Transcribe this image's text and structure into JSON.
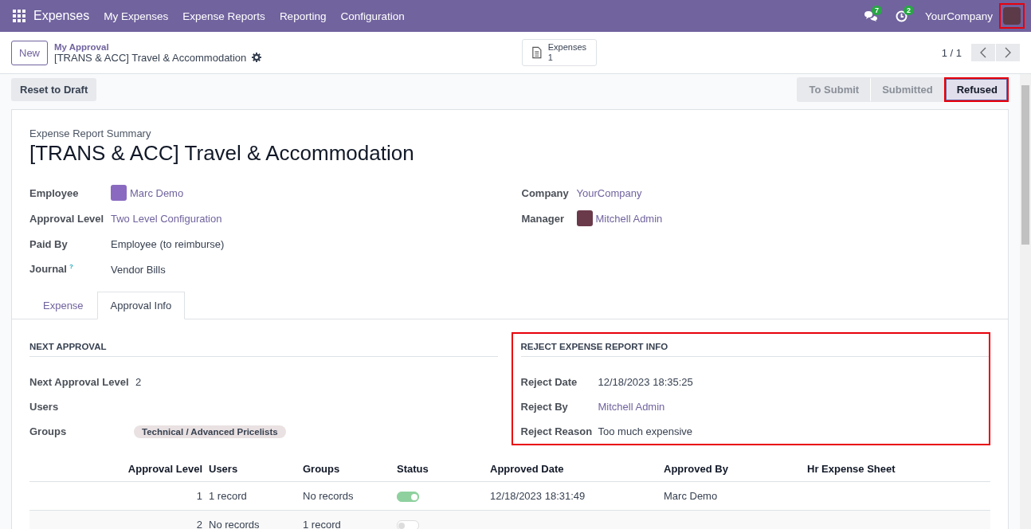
{
  "navbar": {
    "app": "Expenses",
    "menu": [
      "My Expenses",
      "Expense Reports",
      "Reporting",
      "Configuration"
    ],
    "messages_count": "7",
    "activities_count": "2",
    "company": "YourCompany",
    "avatar_highlighted": true
  },
  "control_panel": {
    "new_button": "New",
    "breadcrumb": "My Approval",
    "record": "[TRANS & ACC] Travel & Accommodation",
    "smart_button": {
      "label": "Expenses",
      "count": "1"
    },
    "pager": "1 / 1"
  },
  "action_button": "Reset to Draft",
  "stages": [
    {
      "label": "To Submit",
      "selected": false,
      "highlighted": false
    },
    {
      "label": "Submitted",
      "selected": false,
      "highlighted": false
    },
    {
      "label": "Refused",
      "selected": true,
      "highlighted": true
    }
  ],
  "sheet": {
    "subtitle": "Expense Report Summary",
    "title": "[TRANS & ACC] Travel & Accommodation",
    "left_fields": [
      {
        "label": "Employee",
        "value": "Marc Demo",
        "kind": "avatar-link"
      },
      {
        "label": "Approval Level",
        "value": "Two Level Configuration",
        "kind": "link"
      },
      {
        "label": "Paid By",
        "value": "Employee (to reimburse)",
        "kind": "text"
      },
      {
        "label": "Journal",
        "help": "?",
        "value": "Vendor Bills",
        "kind": "text"
      }
    ],
    "right_fields": [
      {
        "label": "Company",
        "value": "YourCompany",
        "kind": "link"
      },
      {
        "label": "Manager",
        "value": "Mitchell Admin",
        "kind": "avatar-link"
      }
    ],
    "tabs": [
      {
        "label": "Expense",
        "selected": false
      },
      {
        "label": "Approval Info",
        "selected": true
      }
    ],
    "next_approval": {
      "heading": "NEXT APPROVAL",
      "fields": [
        {
          "label": "Next Approval Level",
          "value": "2",
          "kind": "text"
        },
        {
          "label": "Users"
        },
        {
          "label": "Groups",
          "value": "Technical / Advanced Pricelists",
          "kind": "tag"
        }
      ]
    },
    "reject_info": {
      "heading": "REJECT EXPENSE REPORT INFO",
      "highlighted": true,
      "fields": [
        {
          "label": "Reject Date",
          "value": "12/18/2023 18:35:25",
          "kind": "text"
        },
        {
          "label": "Reject By",
          "value": "Mitchell Admin",
          "kind": "link"
        },
        {
          "label": "Reject Reason",
          "value": "Too much expensive",
          "kind": "text"
        }
      ]
    },
    "table": {
      "columns": [
        "Approval Level",
        "Users",
        "Groups",
        "Status",
        "Approved Date",
        "Approved By",
        "Hr Expense Sheet"
      ],
      "rows": [
        {
          "level": "1",
          "users": "1 record",
          "groups": "No records",
          "on": true,
          "approved_date": "12/18/2023 18:31:49",
          "approved_by": "Marc Demo"
        },
        {
          "level": "2",
          "users": "No records",
          "groups": "1 record",
          "on": false
        }
      ]
    }
  }
}
